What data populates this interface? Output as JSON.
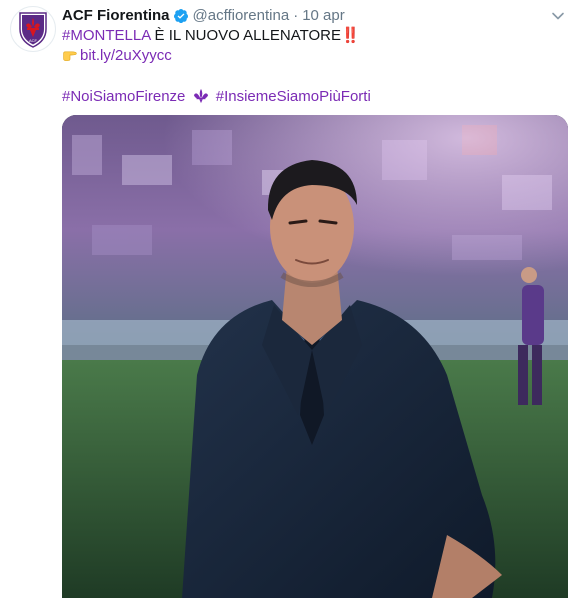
{
  "tweet": {
    "author_name": "ACF Fiorentina",
    "handle": "@acffiorentina",
    "separator": "·",
    "date": "10 apr",
    "verified": true,
    "line1": {
      "hashtag": "#MONTELLA",
      "text": " È IL NUOVO ALLENATORE",
      "emoji": "‼️"
    },
    "line2": {
      "emoji": "pointing-right-hand-emoji",
      "link": "bit.ly/2uXyycc"
    },
    "line3": {
      "hashtag1": "#NoiSiamoFirenze",
      "emoji": "fleur-de-lis-emoji",
      "hashtag2": "#InsiemeSiamoPiùForti"
    },
    "media": {
      "description_icon": "photo-of-coach"
    }
  },
  "colors": {
    "hashtag": "#7b2bb5",
    "verified": "#1da1f2",
    "muted": "#657786",
    "fiorentina_purple": "#5b2a86"
  }
}
